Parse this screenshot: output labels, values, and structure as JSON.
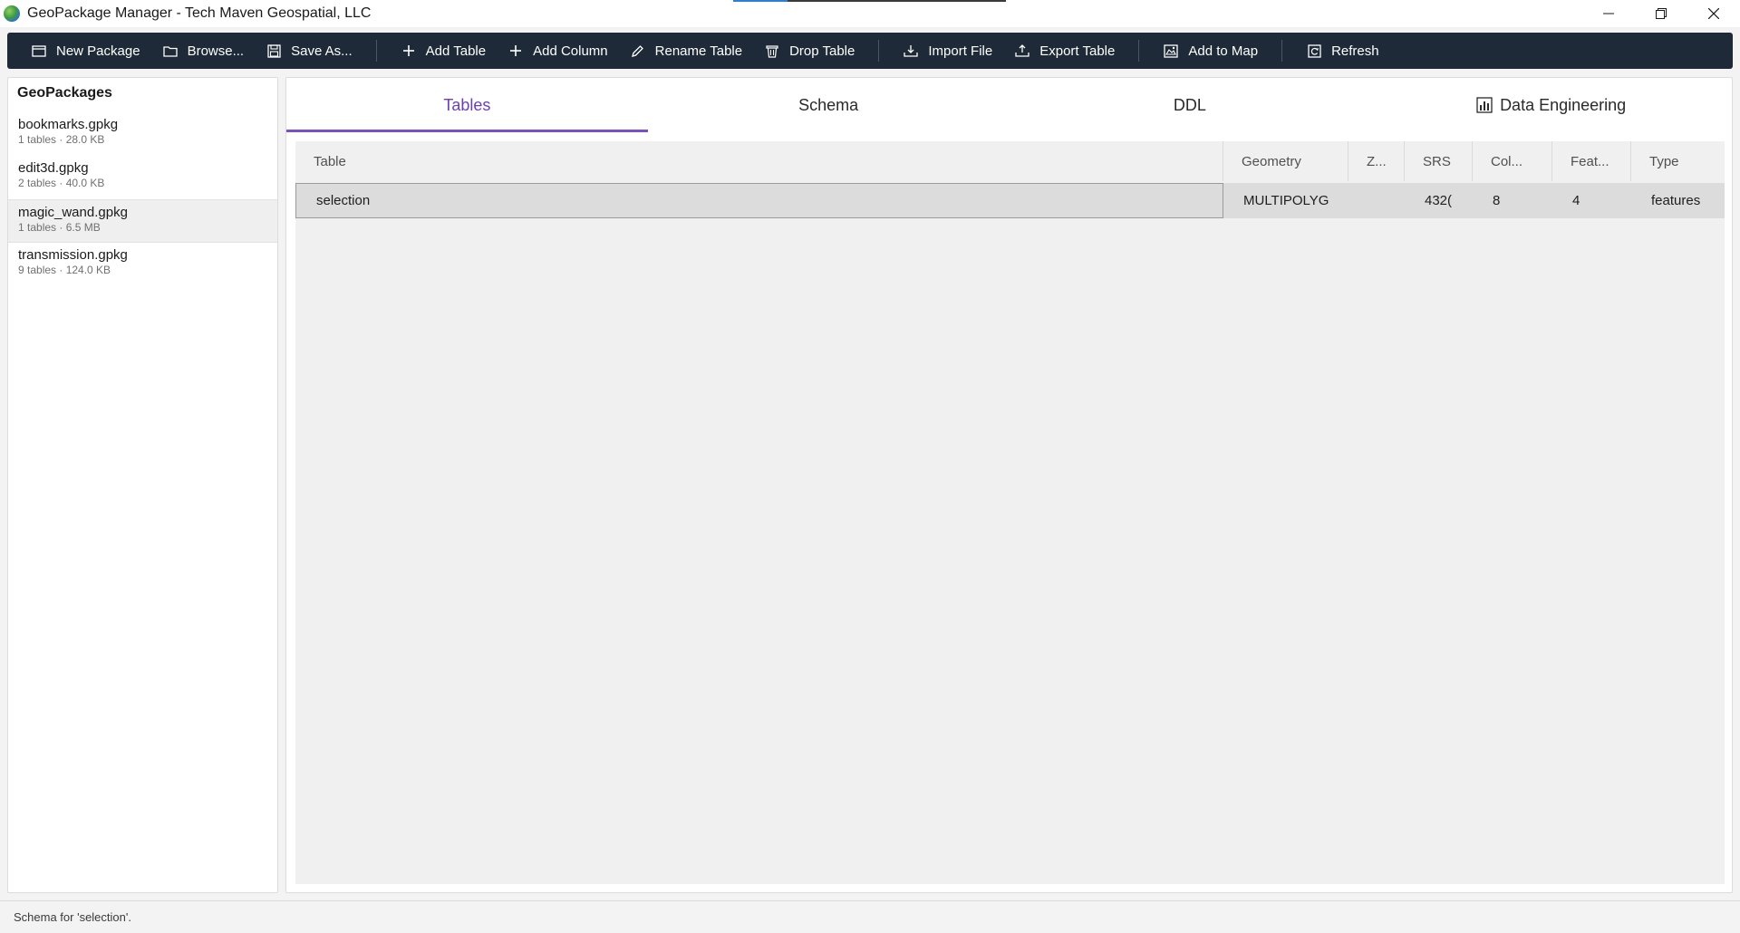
{
  "window": {
    "title": "GeoPackage Manager - Tech Maven Geospatial, LLC",
    "progress_fraction": 0.2
  },
  "toolbar": {
    "new_package": "New Package",
    "browse": "Browse...",
    "save_as": "Save As...",
    "add_table": "Add Table",
    "add_column": "Add Column",
    "rename_table": "Rename Table",
    "drop_table": "Drop Table",
    "import_file": "Import File",
    "export_table": "Export Table",
    "add_to_map": "Add to Map",
    "refresh": "Refresh"
  },
  "sidebar": {
    "heading": "GeoPackages",
    "packages": [
      {
        "name": "bookmarks.gpkg",
        "meta": "1 tables · 28.0 KB"
      },
      {
        "name": "edit3d.gpkg",
        "meta": "2 tables · 40.0 KB"
      },
      {
        "name": "magic_wand.gpkg",
        "meta": "1 tables · 6.5 MB"
      },
      {
        "name": "transmission.gpkg",
        "meta": "9 tables · 124.0 KB"
      }
    ],
    "selected_index": 2
  },
  "tabs": [
    {
      "label": "Tables"
    },
    {
      "label": "Schema"
    },
    {
      "label": "DDL"
    },
    {
      "label": "Data Engineering"
    }
  ],
  "grid": {
    "columns": [
      "Table",
      "Geometry",
      "Z...",
      "SRS",
      "Col...",
      "Feat...",
      "Type"
    ],
    "rows": [
      {
        "table": "selection",
        "geometry": "MULTIPOLYG",
        "z": "",
        "srs": "432(",
        "cols": "8",
        "features": "4",
        "type": "features"
      }
    ]
  },
  "status": {
    "text": "Schema for 'selection'."
  },
  "colors": {
    "toolbar_bg": "#1f2a38",
    "tab_accent": "#7a4fc9",
    "progress": "#2d7fd6"
  }
}
